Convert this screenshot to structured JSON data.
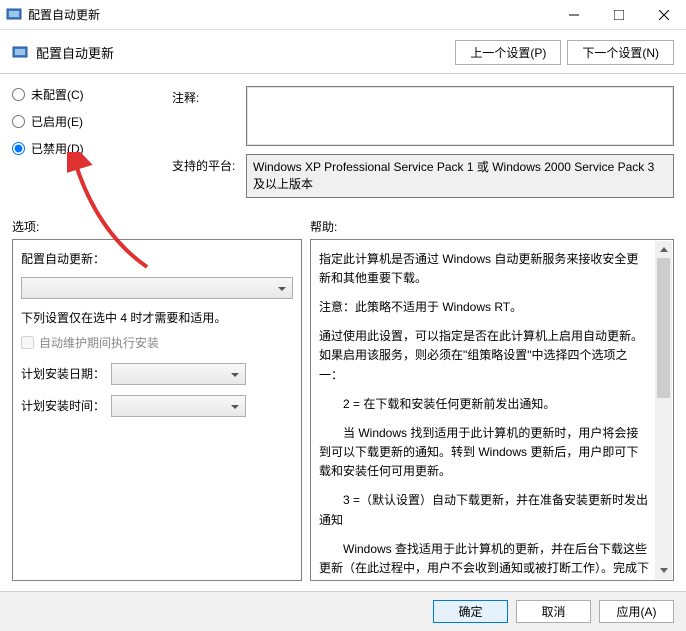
{
  "titlebar": {
    "title": "配置自动更新"
  },
  "header": {
    "title": "配置自动更新",
    "prev_btn": "上一个设置(P)",
    "next_btn": "下一个设置(N)"
  },
  "radios": {
    "not_configured": "未配置(C)",
    "enabled": "已启用(E)",
    "disabled": "已禁用(D)"
  },
  "fields": {
    "comment_label": "注释:",
    "comment_value": "",
    "platform_label": "支持的平台:",
    "platform_value": "Windows XP Professional Service Pack 1 或 Windows 2000 Service Pack 3 及以上版本"
  },
  "sections": {
    "options": "选项:",
    "help": "帮助:"
  },
  "options": {
    "config_label": "配置自动更新：",
    "note": "下列设置仅在选中 4 时才需要和适用。",
    "maint_check": "自动维护期间执行安装",
    "sched_day": "计划安装日期：",
    "sched_time": "计划安装时间："
  },
  "help": {
    "p1": "指定此计算机是否通过 Windows 自动更新服务来接收安全更新和其他重要下载。",
    "p2": "注意：此策略不适用于 Windows RT。",
    "p3": "通过使用此设置，可以指定是否在此计算机上启用自动更新。如果启用该服务，则必须在\"组策略设置\"中选择四个选项之一：",
    "p4": "2 = 在下载和安装任何更新前发出通知。",
    "p5": "当 Windows 找到适用于此计算机的更新时，用户将会接到可以下载更新的通知。转到 Windows 更新后，用户即可下载和安装任何可用更新。",
    "p6": "3 =（默认设置）自动下载更新，并在准备安装更新时发出通知",
    "p7": "Windows 查找适用于此计算机的更新，并在后台下载这些更新（在此过程中，用户不会收到通知或被打断工作）。完成下载后，用户将收到可以安装更新的通知。转到 Windows 更新后，用户即可安装更新。"
  },
  "footer": {
    "ok": "确定",
    "cancel": "取消",
    "apply": "应用(A)"
  }
}
